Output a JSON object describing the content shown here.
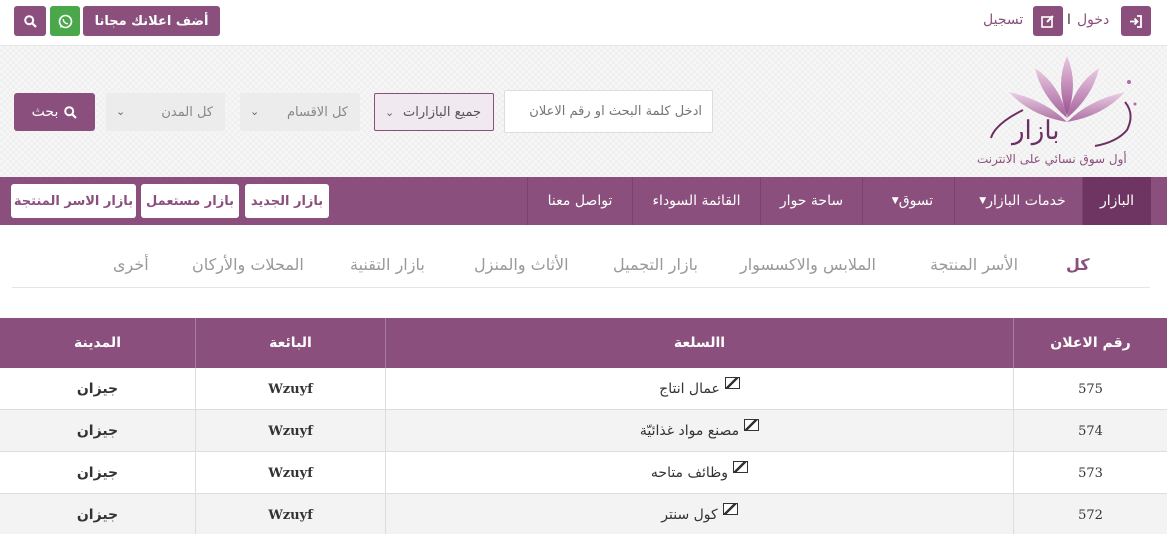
{
  "topbar": {
    "add_ad_label": "أضف اعلانك مجانا",
    "login_label": "دخول",
    "separator": "ا",
    "register_label": "تسجيل"
  },
  "header": {
    "logo_word": "بازار",
    "tagline": "أول سوق نسائي على الانترنت",
    "search": {
      "placeholder": "ادخل كلمة البحث او رقم الاعلان"
    },
    "selects": {
      "bazaar": "جميع البازارات",
      "categories": "كل الاقسام",
      "cities": "كل المدن"
    },
    "search_button_label": "بحث"
  },
  "nav": {
    "items": [
      {
        "label": "البازار"
      },
      {
        "label": "خدمات البازار"
      },
      {
        "label": "تسوق"
      },
      {
        "label": "ساحة حوار"
      },
      {
        "label": "القائمة السوداء"
      },
      {
        "label": "تواصل معنا"
      }
    ],
    "pills": [
      {
        "label": "بازار الجديد"
      },
      {
        "label": "بازار مستعمل"
      },
      {
        "label": "بازار الاسر المنتجة"
      }
    ]
  },
  "categories": [
    {
      "label": "كل"
    },
    {
      "label": "الأسر المنتجة"
    },
    {
      "label": "الملابس والاكسسوار"
    },
    {
      "label": "بازار التجميل"
    },
    {
      "label": "الأثاث والمنزل"
    },
    {
      "label": "بازار التقنية"
    },
    {
      "label": "المحلات والأركان"
    },
    {
      "label": "أخرى"
    }
  ],
  "table": {
    "headers": {
      "ad_number": "رقم الاعلان",
      "item": "االسلعة",
      "seller": "البائعة",
      "city": "المدينة"
    },
    "rows": [
      {
        "id": "575",
        "item": "عمال انتاج",
        "seller": "Wzuyf",
        "city": "جيزان"
      },
      {
        "id": "574",
        "item": "مصنع مواد غذائيّة",
        "seller": "Wzuyf",
        "city": "جيزان"
      },
      {
        "id": "573",
        "item": "وظائف متاحه",
        "seller": "Wzuyf",
        "city": "جيزان"
      },
      {
        "id": "572",
        "item": "كول سنتر",
        "seller": "Wzuyf",
        "city": "جيزان"
      }
    ]
  },
  "colors": {
    "brand": "#8b4f7e",
    "whatsapp": "#4aa84a"
  }
}
